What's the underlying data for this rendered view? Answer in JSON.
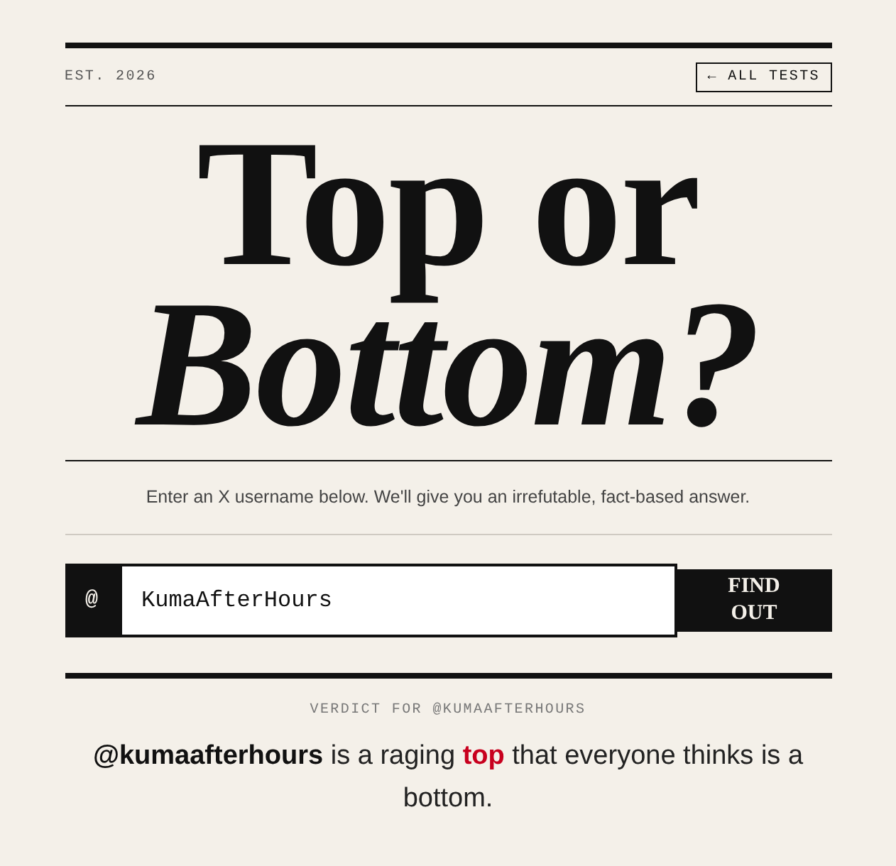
{
  "masthead": {
    "established": "EST. 2026",
    "back_link": "← ALL TESTS"
  },
  "headline": {
    "upright": "Top or",
    "italic": "Bottom?"
  },
  "subtitle": "Enter an X username below. We'll give you an irrefutable, fact-based answer.",
  "form": {
    "prefix": "@",
    "username": "KumaAfterHours",
    "button": "FIND OUT"
  },
  "verdict": {
    "label": "VERDICT FOR @KUMAAFTERHOURS",
    "parts": [
      {
        "kind": "handle",
        "text": "@kumaafterhours"
      },
      {
        "kind": "plain",
        "text": " is a raging "
      },
      {
        "kind": "answer",
        "text": "top"
      },
      {
        "kind": "plain",
        "text": " that everyone thinks is a bottom."
      }
    ]
  }
}
